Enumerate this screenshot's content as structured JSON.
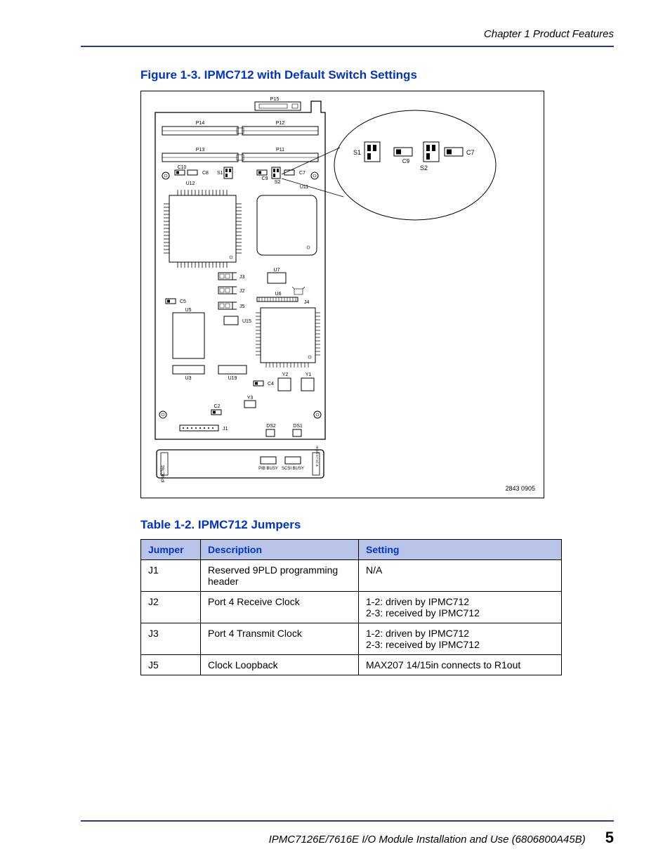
{
  "header": {
    "chapter": "Chapter 1  Product Features"
  },
  "figure": {
    "title": "Figure 1-3. IPMC712 with Default Switch Settings",
    "diagram_id": "2843 0905",
    "board_label": "IPMC761",
    "connectors": {
      "P11": "P11",
      "P12": "P12",
      "P13": "P13",
      "P14": "P14",
      "P15": "P15"
    },
    "components": {
      "C2": "C2",
      "C4": "C4",
      "C5": "C5",
      "C7": "C7",
      "C8": "C8",
      "C9": "C9",
      "C10": "C10",
      "S1": "S1",
      "S2": "S2",
      "J1": "J1",
      "J2": "J2",
      "J3": "J3",
      "J4": "J4",
      "J5": "J5",
      "U3": "U3",
      "U5": "U5",
      "U6": "U6",
      "U7": "U7",
      "U11": "U11",
      "U12": "U12",
      "U15": "U15",
      "U19": "U19",
      "Y1": "Y1",
      "Y2": "Y2",
      "Y3": "Y3",
      "DS1": "DS1",
      "DS2": "DS2"
    },
    "leds": {
      "pib": "PIB BUSY",
      "scsi": "SCSI BUSY"
    },
    "callout": {
      "S1": "S1",
      "S2": "S2",
      "C7": "C7",
      "C9": "C9"
    }
  },
  "table": {
    "title": "Table 1-2. IPMC712 Jumpers",
    "headers": {
      "jumper": "Jumper",
      "desc": "Description",
      "setting": "Setting"
    },
    "rows": [
      {
        "j": "J1",
        "d": "Reserved 9PLD programming header",
        "s": "N/A"
      },
      {
        "j": "J2",
        "d": "Port 4 Receive Clock",
        "s": "1-2: driven by IPMC712\n2-3: received by IPMC712"
      },
      {
        "j": "J3",
        "d": "Port 4 Transmit Clock",
        "s": "1-2: driven by IPMC712\n2-3: received by IPMC712"
      },
      {
        "j": "J5",
        "d": "Clock Loopback",
        "s": "MAX207 14/15in connects to R1out"
      }
    ]
  },
  "footer": {
    "text": "IPMC7126E/7616E I/O Module Installation and Use (6806800A45B)",
    "page": "5"
  }
}
